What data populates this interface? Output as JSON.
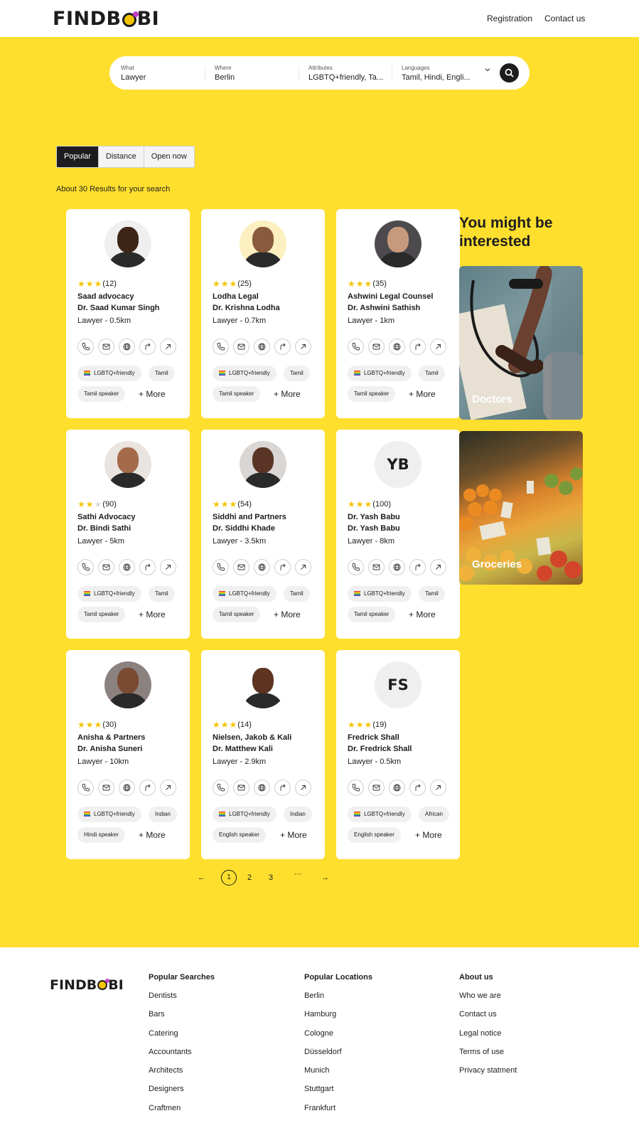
{
  "header": {
    "logo": "FINDBOBI",
    "nav": [
      "Registration",
      "Contact us"
    ]
  },
  "search": {
    "what": {
      "label": "What",
      "value": "Lawyer"
    },
    "where": {
      "label": "Where",
      "value": "Berlin"
    },
    "attributes": {
      "label": "Attributes",
      "value": "LGBTQ+friendly, Ta..."
    },
    "languages": {
      "label": "Languages",
      "value": "Tamil, Hindi, Engli..."
    }
  },
  "sort": {
    "tabs": [
      "Popular",
      "Distance",
      "Open now"
    ],
    "active": "Popular"
  },
  "results_text": "About 30 Results for your search",
  "cards": [
    {
      "rating": 3,
      "reviews": "(12)",
      "name": "Saad advocacy",
      "person": "Dr. Saad Kumar Singh",
      "distance": "Lawyer - 0.5km",
      "tags": [
        "LGBTQ+friendly",
        "Tamil",
        "Tamil speaker"
      ],
      "more": "+ More",
      "avatar": "photo",
      "skin": "#3d2417",
      "bg": "#efefef"
    },
    {
      "rating": 3,
      "reviews": "(25)",
      "name": "Lodha Legal",
      "person": "Dr. Krishna Lodha",
      "distance": "Lawyer - 0.7km",
      "tags": [
        "LGBTQ+friendly",
        "Tamil",
        "Tamil speaker"
      ],
      "more": "+ More",
      "avatar": "photo",
      "skin": "#8a5a3c",
      "bg": "#fdf0c0"
    },
    {
      "rating": 3,
      "reviews": "(35)",
      "name": "Ashwini Legal Counsel",
      "person": "Dr. Ashwini Sathish",
      "distance": "Lawyer - 1km",
      "tags": [
        "LGBTQ+friendly",
        "Tamil",
        "Tamil speaker"
      ],
      "more": "+ More",
      "avatar": "photo",
      "skin": "#c79a7e",
      "bg": "#4d4a4e"
    },
    {
      "rating": 2,
      "reviews": "(90)",
      "name": "Sathi Advocacy",
      "person": "Dr. Bindi Sathi",
      "distance": "Lawyer - 5km",
      "tags": [
        "LGBTQ+friendly",
        "Tamil",
        "Tamil speaker"
      ],
      "more": "+ More",
      "avatar": "photo",
      "skin": "#a46a4a",
      "bg": "#e9e4e0"
    },
    {
      "rating": 3,
      "reviews": "(54)",
      "name": "Siddhi and Partners",
      "person": "Dr. Siddhi Khade",
      "distance": "Lawyer - 3.5km",
      "tags": [
        "LGBTQ+friendly",
        "Tamil",
        "Tamil speaker"
      ],
      "more": "+ More",
      "avatar": "photo",
      "skin": "#5a3424",
      "bg": "#d9d6d4"
    },
    {
      "rating": 3,
      "reviews": "(100)",
      "name": "Dr. Yash Babu",
      "person": "Dr. Yash Babu",
      "distance": "Lawyer - 8km",
      "tags": [
        "LGBTQ+friendly",
        "Tamil",
        "Tamil speaker"
      ],
      "more": "+ More",
      "avatar": "initials",
      "initials": "YB"
    },
    {
      "rating": 3,
      "reviews": "(30)",
      "name": "Anisha & Partners",
      "person": "Dr. Anisha Suneri",
      "distance": "Lawyer - 10km",
      "tags": [
        "LGBTQ+friendly",
        "Indian",
        "Hindi speaker"
      ],
      "more": "+ More",
      "avatar": "photo",
      "skin": "#7a4a32",
      "bg": "#8b8280"
    },
    {
      "rating": 3,
      "reviews": "(14)",
      "name": "Nielsen, Jakob & Kali",
      "person": "Dr. Matthew Kali",
      "distance": "Lawyer - 2.9km",
      "tags": [
        "LGBTQ+friendly",
        "Indian",
        "English speaker"
      ],
      "more": "+ More",
      "avatar": "photo",
      "skin": "#5c3420",
      "bg": "#ffffff"
    },
    {
      "rating": 3,
      "reviews": "(19)",
      "name": "Fredrick Shall",
      "person": "Dr. Fredrick Shall",
      "distance": "Lawyer - 0.5km",
      "tags": [
        "LGBTQ+friendly",
        "African",
        "English speaker"
      ],
      "more": "+ More",
      "avatar": "initials",
      "initials": "FS"
    }
  ],
  "sidebar": {
    "title": "You might be interested",
    "promos": [
      {
        "label": "Doctors"
      },
      {
        "label": "Groceries"
      }
    ]
  },
  "pagination": {
    "prev": "←",
    "pages": [
      "1",
      "2",
      "3"
    ],
    "ellipsis": "···",
    "next": "→",
    "current": "1"
  },
  "footer": {
    "logo": "FINDBOBI",
    "popular_searches": {
      "title": "Popular Searches",
      "items": [
        "Dentists",
        "Bars",
        "Catering",
        "Accountants",
        "Architects",
        "Designers",
        "Craftmen"
      ]
    },
    "popular_locations": {
      "title": "Popular Locations",
      "items": [
        "Berlin",
        "Hamburg",
        "Cologne",
        "Düsseldorf",
        "Munich",
        "Stuttgart",
        "Frankfurt"
      ]
    },
    "about": {
      "title": "About us",
      "items": [
        "Who we are",
        "Contact us",
        "Legal notice",
        "Terms of use",
        "Privacy statment"
      ]
    }
  },
  "colors": {
    "accent": "#fedf2e",
    "dark": "#1d1d1f",
    "star": "#f5c400"
  }
}
